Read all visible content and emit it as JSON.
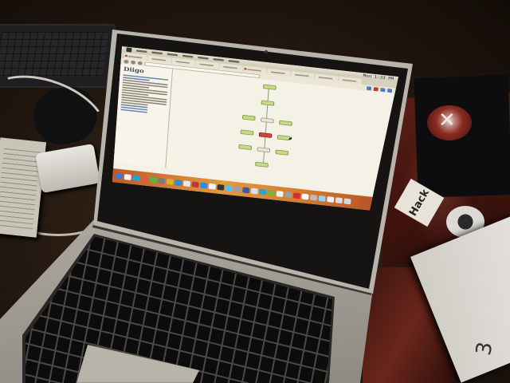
{
  "scene": {
    "description_free": true
  },
  "screen": {
    "menubar": {
      "clock": "Mon 1:33 PM"
    },
    "sidebar": {
      "logo": "Diigo"
    },
    "tabs": [
      {
        "favicon": "red"
      },
      {
        "favicon": "none"
      },
      {
        "favicon": "none"
      },
      {
        "favicon": "none"
      },
      {
        "favicon": "none"
      },
      {
        "favicon": "red"
      },
      {
        "favicon": "none"
      },
      {
        "favicon": "none"
      },
      {
        "favicon": "none"
      },
      {
        "favicon": "none"
      }
    ],
    "dock_colors": [
      "#3b7ad6",
      "#f2f2f2",
      "#2a9fd8",
      "#e25b3a",
      "#5ab045",
      "#7a7a7a",
      "#d9b230",
      "#2b8fd8",
      "#e8e8e8",
      "#bf3a2c",
      "#1e90ff",
      "#f2f2f2",
      "#333333",
      "#4fc3f7",
      "#9e9e9e",
      "#3b5ba9",
      "#e0e0e0",
      "#2aa4d6",
      "#7cb342",
      "#f2f2f2",
      "#90a4ae",
      "#d32f2f",
      "#ffffff",
      "#bdbdbd",
      "#9ad0f5",
      "#f2f2f2",
      "#e0e0e0",
      "#cfd8dc"
    ]
  },
  "objects": {
    "sticker_text": "Hack",
    "card_number": "3"
  },
  "colors": {
    "node_green": "#c8d98a",
    "node_red": "#d2433a",
    "dock_orange": "#e29a3e"
  }
}
